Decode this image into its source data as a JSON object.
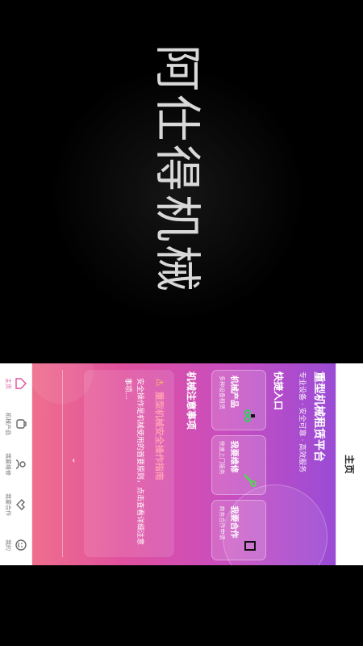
{
  "hero": {
    "brand": "阿仕得机械"
  },
  "titlebar": {
    "title": "主页"
  },
  "banner": {
    "title": "重型机械租赁平台",
    "subtitle": "专业设备 · 安全可靠 · 高效服务"
  },
  "quick_entry": {
    "title": "快捷入口",
    "cards": [
      {
        "label": "机械产品",
        "sub": "多种设备租赁",
        "icon": "excavator-icon",
        "accent": "#2bd15a"
      },
      {
        "label": "我要维修",
        "sub": "快速上门服务",
        "icon": "wrench-icon",
        "accent": "#5ad15a"
      },
      {
        "label": "我要合作",
        "sub": "商务合作申请",
        "icon": "handshake-icon",
        "accent": "#222222"
      }
    ]
  },
  "notice": {
    "section_title": "机械注意事项",
    "title": "重型机械安全操作指南",
    "body": "安全操作是机械使用的首要原则，点击查看详细注意事项..."
  },
  "tabbar": {
    "items": [
      {
        "label": "主页",
        "icon": "home-icon",
        "active": true
      },
      {
        "label": "机械产品",
        "icon": "tool-icon",
        "active": false
      },
      {
        "label": "我要维修",
        "icon": "repair-icon",
        "active": false
      },
      {
        "label": "我要合作",
        "icon": "handshake-icon",
        "active": false
      },
      {
        "label": "我的",
        "icon": "profile-icon",
        "active": false
      }
    ]
  },
  "colors": {
    "accent": "#e0509e",
    "gradient_top": "#9a4bd6",
    "gradient_bottom": "#ef6f8e"
  }
}
